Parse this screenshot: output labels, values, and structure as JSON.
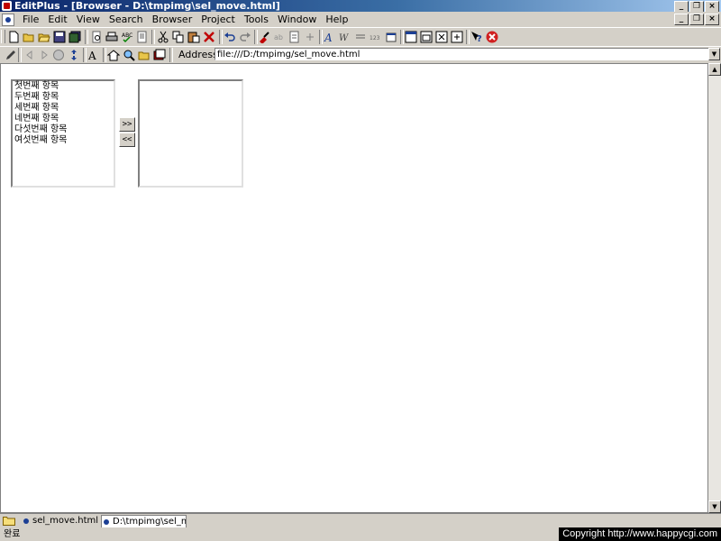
{
  "window": {
    "title": "EditPlus - [Browser - D:\\tmpimg\\sel_move.html]"
  },
  "menubar": [
    "File",
    "Edit",
    "View",
    "Search",
    "Browser",
    "Project",
    "Tools",
    "Window",
    "Help"
  ],
  "toolbar_row1_icons": [
    "new-icon",
    "open-icon",
    "open-folder-icon",
    "save-icon",
    "save-all-icon",
    "print-preview-icon",
    "print-icon",
    "spell-check-icon",
    "cut-icon",
    "copy-icon",
    "paste-icon",
    "delete-icon",
    "undo-icon",
    "redo-icon",
    "find-icon",
    "replace-icon",
    "goto-icon",
    "word-wrap-icon",
    "font-icon",
    "word-icon",
    "line-number-icon",
    "ruler-icon",
    "column-icon",
    "window-icon",
    "help-icon",
    "close-red-icon"
  ],
  "address": {
    "label": "Address",
    "value": "file:///D:/tmpimg/sel_move.html"
  },
  "page": {
    "left_list": [
      "첫번째 항목",
      "두번째 항목",
      "세번째 항목",
      "네번째 항목",
      "다섯번째 항목",
      "여섯번째 항목"
    ],
    "right_list": [],
    "move_right_label": ">>",
    "move_left_label": "<<"
  },
  "tabs": [
    {
      "label": "sel_move.html",
      "active": false
    },
    {
      "label": "D:\\tmpimg\\sel_m",
      "active": true
    }
  ],
  "status": {
    "text": "완료",
    "copyright": "Copyright  http://www.happycgi.com"
  }
}
